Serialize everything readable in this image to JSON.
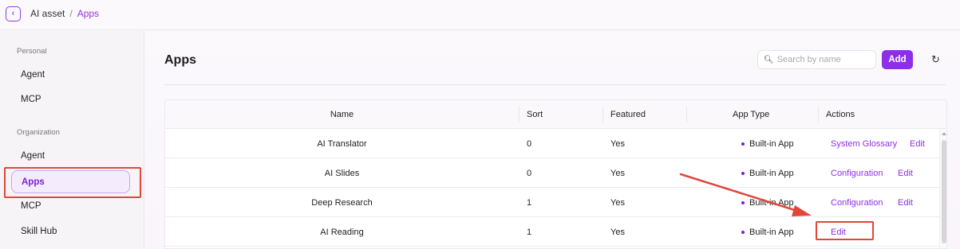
{
  "breadcrumb": {
    "root": "AI asset",
    "separator": "/",
    "current": "Apps"
  },
  "sidebar": {
    "personal_title": "Personal",
    "personal_items": [
      "Agent",
      "MCP"
    ],
    "org_title": "Organization",
    "org_items": [
      "Agent",
      "Apps",
      "MCP",
      "Skill Hub"
    ],
    "active_item": "Apps"
  },
  "main": {
    "title": "Apps",
    "search_placeholder": "Search by name",
    "add_label": "Add"
  },
  "table": {
    "columns": [
      "Name",
      "Sort",
      "Featured",
      "App Type",
      "Actions"
    ],
    "rows": [
      {
        "name": "AI Translator",
        "sort": "0",
        "featured": "Yes",
        "type": "Built-in App",
        "actions": [
          "System Glossary",
          "Edit"
        ]
      },
      {
        "name": "AI Slides",
        "sort": "0",
        "featured": "Yes",
        "type": "Built-in App",
        "actions": [
          "Configuration",
          "Edit"
        ]
      },
      {
        "name": "Deep Research",
        "sort": "1",
        "featured": "Yes",
        "type": "Built-in App",
        "actions": [
          "Configuration",
          "Edit"
        ]
      },
      {
        "name": "AI Reading",
        "sort": "1",
        "featured": "Yes",
        "type": "Built-in App",
        "actions": [
          "Edit"
        ]
      }
    ]
  },
  "colors": {
    "accent": "#8e2fe8",
    "annotation": "#e0463a"
  }
}
